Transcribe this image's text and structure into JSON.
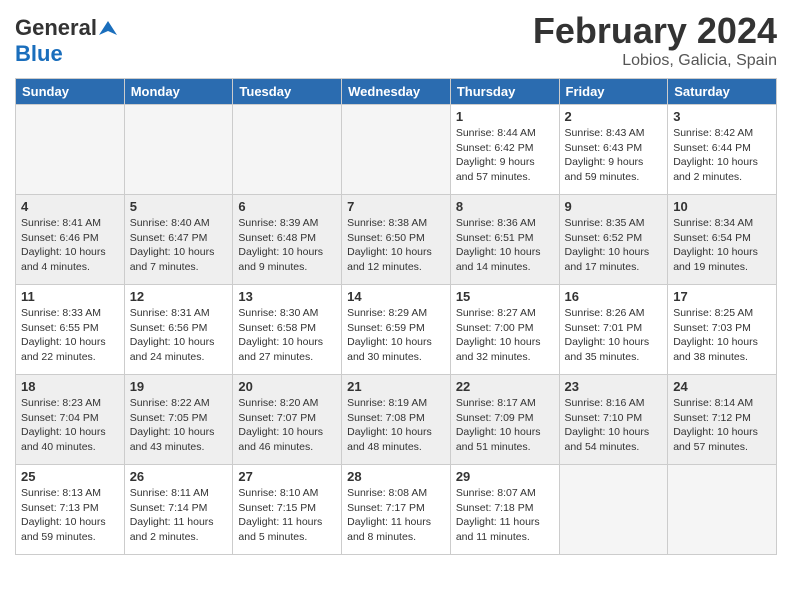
{
  "header": {
    "logo_general": "General",
    "logo_blue": "Blue",
    "month_year": "February 2024",
    "location": "Lobios, Galicia, Spain"
  },
  "weekdays": [
    "Sunday",
    "Monday",
    "Tuesday",
    "Wednesday",
    "Thursday",
    "Friday",
    "Saturday"
  ],
  "weeks": [
    [
      {
        "day": "",
        "info": ""
      },
      {
        "day": "",
        "info": ""
      },
      {
        "day": "",
        "info": ""
      },
      {
        "day": "",
        "info": ""
      },
      {
        "day": "1",
        "info": "Sunrise: 8:44 AM\nSunset: 6:42 PM\nDaylight: 9 hours and 57 minutes."
      },
      {
        "day": "2",
        "info": "Sunrise: 8:43 AM\nSunset: 6:43 PM\nDaylight: 9 hours and 59 minutes."
      },
      {
        "day": "3",
        "info": "Sunrise: 8:42 AM\nSunset: 6:44 PM\nDaylight: 10 hours and 2 minutes."
      }
    ],
    [
      {
        "day": "4",
        "info": "Sunrise: 8:41 AM\nSunset: 6:46 PM\nDaylight: 10 hours and 4 minutes."
      },
      {
        "day": "5",
        "info": "Sunrise: 8:40 AM\nSunset: 6:47 PM\nDaylight: 10 hours and 7 minutes."
      },
      {
        "day": "6",
        "info": "Sunrise: 8:39 AM\nSunset: 6:48 PM\nDaylight: 10 hours and 9 minutes."
      },
      {
        "day": "7",
        "info": "Sunrise: 8:38 AM\nSunset: 6:50 PM\nDaylight: 10 hours and 12 minutes."
      },
      {
        "day": "8",
        "info": "Sunrise: 8:36 AM\nSunset: 6:51 PM\nDaylight: 10 hours and 14 minutes."
      },
      {
        "day": "9",
        "info": "Sunrise: 8:35 AM\nSunset: 6:52 PM\nDaylight: 10 hours and 17 minutes."
      },
      {
        "day": "10",
        "info": "Sunrise: 8:34 AM\nSunset: 6:54 PM\nDaylight: 10 hours and 19 minutes."
      }
    ],
    [
      {
        "day": "11",
        "info": "Sunrise: 8:33 AM\nSunset: 6:55 PM\nDaylight: 10 hours and 22 minutes."
      },
      {
        "day": "12",
        "info": "Sunrise: 8:31 AM\nSunset: 6:56 PM\nDaylight: 10 hours and 24 minutes."
      },
      {
        "day": "13",
        "info": "Sunrise: 8:30 AM\nSunset: 6:58 PM\nDaylight: 10 hours and 27 minutes."
      },
      {
        "day": "14",
        "info": "Sunrise: 8:29 AM\nSunset: 6:59 PM\nDaylight: 10 hours and 30 minutes."
      },
      {
        "day": "15",
        "info": "Sunrise: 8:27 AM\nSunset: 7:00 PM\nDaylight: 10 hours and 32 minutes."
      },
      {
        "day": "16",
        "info": "Sunrise: 8:26 AM\nSunset: 7:01 PM\nDaylight: 10 hours and 35 minutes."
      },
      {
        "day": "17",
        "info": "Sunrise: 8:25 AM\nSunset: 7:03 PM\nDaylight: 10 hours and 38 minutes."
      }
    ],
    [
      {
        "day": "18",
        "info": "Sunrise: 8:23 AM\nSunset: 7:04 PM\nDaylight: 10 hours and 40 minutes."
      },
      {
        "day": "19",
        "info": "Sunrise: 8:22 AM\nSunset: 7:05 PM\nDaylight: 10 hours and 43 minutes."
      },
      {
        "day": "20",
        "info": "Sunrise: 8:20 AM\nSunset: 7:07 PM\nDaylight: 10 hours and 46 minutes."
      },
      {
        "day": "21",
        "info": "Sunrise: 8:19 AM\nSunset: 7:08 PM\nDaylight: 10 hours and 48 minutes."
      },
      {
        "day": "22",
        "info": "Sunrise: 8:17 AM\nSunset: 7:09 PM\nDaylight: 10 hours and 51 minutes."
      },
      {
        "day": "23",
        "info": "Sunrise: 8:16 AM\nSunset: 7:10 PM\nDaylight: 10 hours and 54 minutes."
      },
      {
        "day": "24",
        "info": "Sunrise: 8:14 AM\nSunset: 7:12 PM\nDaylight: 10 hours and 57 minutes."
      }
    ],
    [
      {
        "day": "25",
        "info": "Sunrise: 8:13 AM\nSunset: 7:13 PM\nDaylight: 10 hours and 59 minutes."
      },
      {
        "day": "26",
        "info": "Sunrise: 8:11 AM\nSunset: 7:14 PM\nDaylight: 11 hours and 2 minutes."
      },
      {
        "day": "27",
        "info": "Sunrise: 8:10 AM\nSunset: 7:15 PM\nDaylight: 11 hours and 5 minutes."
      },
      {
        "day": "28",
        "info": "Sunrise: 8:08 AM\nSunset: 7:17 PM\nDaylight: 11 hours and 8 minutes."
      },
      {
        "day": "29",
        "info": "Sunrise: 8:07 AM\nSunset: 7:18 PM\nDaylight: 11 hours and 11 minutes."
      },
      {
        "day": "",
        "info": ""
      },
      {
        "day": "",
        "info": ""
      }
    ]
  ]
}
